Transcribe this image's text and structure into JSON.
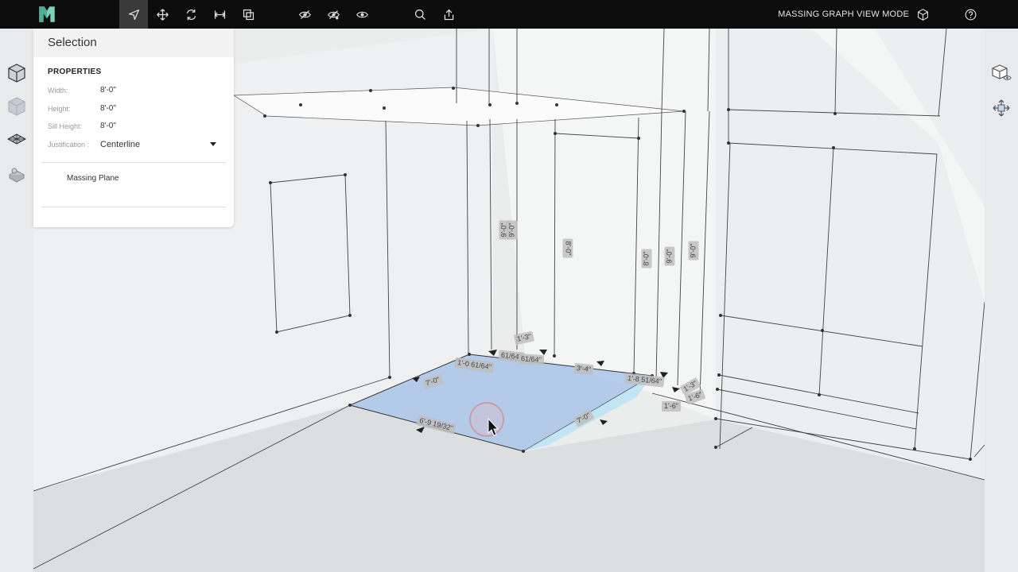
{
  "toolbar": {
    "tools": [
      {
        "name": "select-tool-icon",
        "active": true
      },
      {
        "name": "move-tool-icon"
      },
      {
        "name": "rotate-tool-icon"
      },
      {
        "name": "measure-tool-icon"
      },
      {
        "name": "group-tool-icon"
      },
      {
        "name": "hide-icon"
      },
      {
        "name": "hide-others-icon"
      },
      {
        "name": "show-all-icon"
      },
      {
        "name": "search-icon"
      },
      {
        "name": "share-icon"
      }
    ],
    "mode_label": "MASSING GRAPH VIEW MODE"
  },
  "panel": {
    "title": "Selection",
    "section": "PROPERTIES",
    "properties": [
      {
        "label": "Width:",
        "value": "8'-0\""
      },
      {
        "label": "Height:",
        "value": "8'-0\""
      },
      {
        "label": "Sill Height:",
        "value": "8'-0\""
      },
      {
        "label": "Justification :",
        "value": "Centerline"
      }
    ],
    "item": "Massing Plane"
  },
  "dimensions": [
    {
      "text": "9'-0\""
    },
    {
      "text": "9'-0\""
    },
    {
      "text": "8'-0\""
    },
    {
      "text": "8'-0\""
    },
    {
      "text": "9'-0\""
    },
    {
      "text": "9'-0\""
    },
    {
      "text": "1'-3\""
    },
    {
      "text": "1'-0 61/64\""
    },
    {
      "text": "61/64\""
    },
    {
      "text": "61/64\""
    },
    {
      "text": "3'-4\""
    },
    {
      "text": "7'-0\""
    },
    {
      "text": "1'-8 51/64\""
    },
    {
      "text": "1'-3\""
    },
    {
      "text": "1'-6\""
    },
    {
      "text": "1'-6\""
    },
    {
      "text": "6'-9 19/32\""
    },
    {
      "text": "7'-0\""
    }
  ],
  "colors": {
    "topbar": "#0c0c0c",
    "accent": "#9fbfe6",
    "panel": "#ffffff"
  }
}
